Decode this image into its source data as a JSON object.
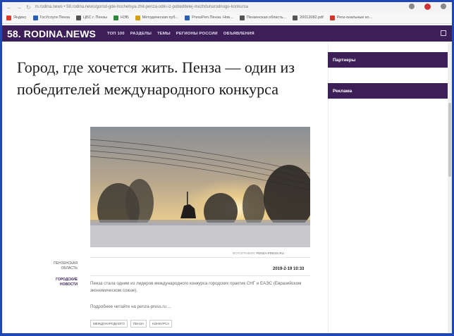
{
  "browser": {
    "address": "m.rodina.news • 58.rodina.news/gorod-gde-hochetsya-zhit-penza-odin-iz-pobeditelej-mezhdunarodnogo-konkursa",
    "bookmarks": [
      {
        "label": "Яндекс",
        "color": "#e03b2a"
      },
      {
        "label": "ГосУслуги Пенза",
        "color": "#2a5fb8"
      },
      {
        "label": "ЦБС г. Пензы",
        "color": "#555555"
      },
      {
        "label": "НЭБ",
        "color": "#2a8a3a"
      },
      {
        "label": "Методическая пуб...",
        "color": "#d4a017"
      },
      {
        "label": "PressPen.Пенза. Нов...",
        "color": "#2a5fb8"
      },
      {
        "label": "Пензенская область...",
        "color": "#555555"
      },
      {
        "label": "20012082.pdf",
        "color": "#555555"
      },
      {
        "label": "Реги-ональные ко...",
        "color": "#d9342b"
      }
    ]
  },
  "site": {
    "logo": "58. RODINA.NEWS",
    "nav": [
      "ТОП 100",
      "РАЗДЕЛЫ",
      "ТЕМЫ",
      "РЕГИОНЫ РОССИИ",
      "ОБЪЯВЛЕНИЯ"
    ],
    "accent": "#3d1f58"
  },
  "article": {
    "title": "Город, где хочется жить. Пенза — один из победителей международного конкурса",
    "photo_credit_label": "ФОТОГРАФИЯ:",
    "photo_credit_source": "PENZA-PRESS.RU",
    "source_label": "ПЕНЗЕНСКАЯ ОБЛАСТЬ",
    "category": "ГОРОДСКИЕ НОВОСТИ",
    "date": "2019-2-19 10:33",
    "text": "Пенза стала одним из лидеров международного конкурса городских практик СНГ и ЕАЭС (Евразийском экономическом союзе).",
    "more": "Подробнее читайте на penza-press.ru ...",
    "tags": [
      "МЕЖДУНАРОДНОГО",
      "ПЕНЗА",
      "КОНКУРСА"
    ]
  },
  "sidebar": {
    "partners": "Партнеры",
    "ads": "Реклама"
  }
}
